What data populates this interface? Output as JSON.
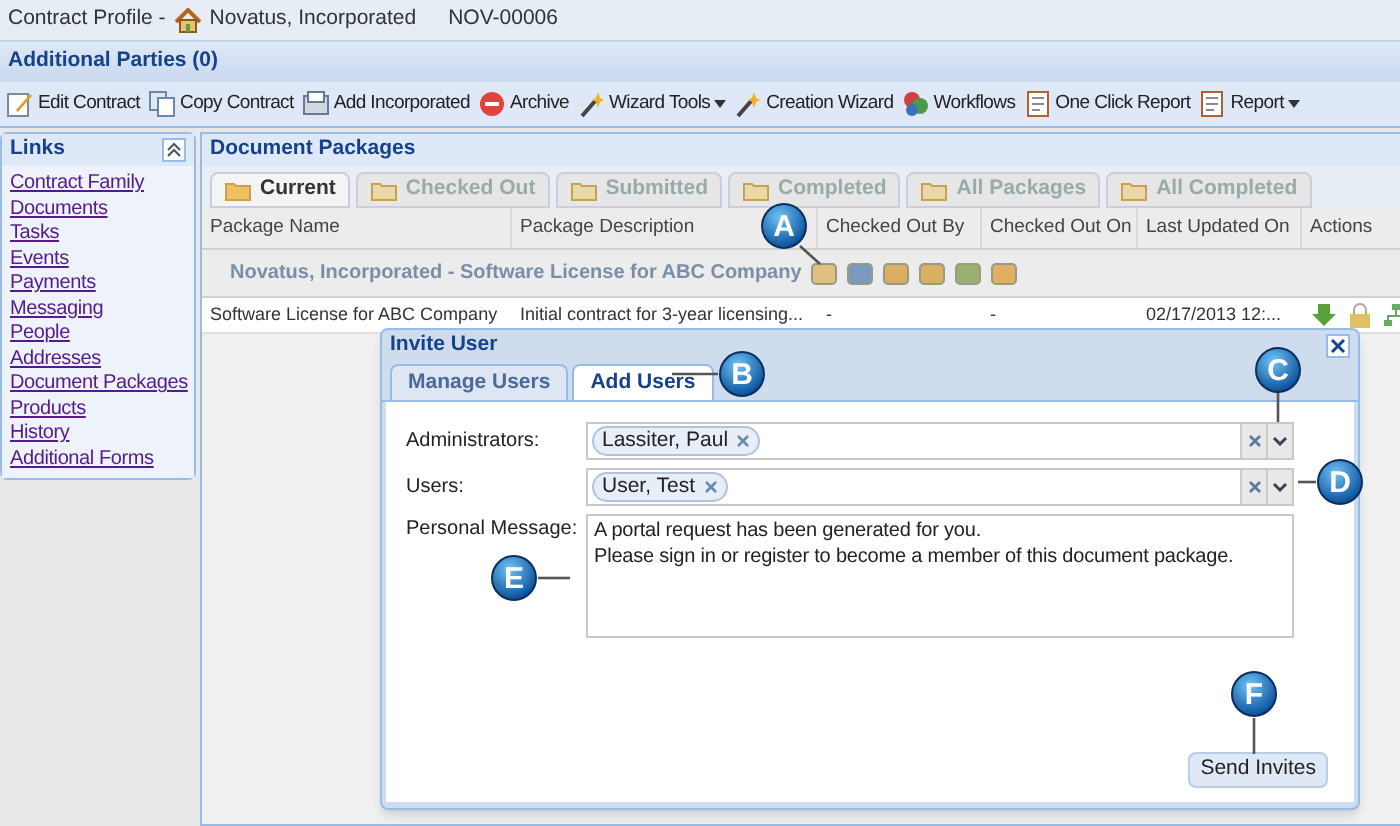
{
  "header": {
    "label": "Contract Profile -",
    "party": "Novatus, Incorporated",
    "code": "NOV-00006"
  },
  "section_title": "Additional Parties (0)",
  "toolbar": [
    {
      "label": "Edit Contract",
      "dropdown": false
    },
    {
      "label": "Copy Contract",
      "dropdown": false
    },
    {
      "label": "Add Incorporated",
      "dropdown": false
    },
    {
      "label": "Archive",
      "dropdown": false
    },
    {
      "label": "Wizard Tools",
      "dropdown": true
    },
    {
      "label": "Creation Wizard",
      "dropdown": false
    },
    {
      "label": "Workflows",
      "dropdown": false
    },
    {
      "label": "One Click Report",
      "dropdown": false
    },
    {
      "label": "Report",
      "dropdown": true
    }
  ],
  "links": {
    "title": "Links",
    "items": [
      "Contract Family",
      "Documents",
      "Tasks",
      "Events",
      "Payments",
      "Messaging",
      "People",
      "Addresses",
      "Document Packages",
      "Products",
      "History",
      "Additional Forms"
    ]
  },
  "document_packages": {
    "title": "Document Packages",
    "tabs": [
      {
        "label": "Current",
        "selected": true
      },
      {
        "label": "Checked Out",
        "selected": false
      },
      {
        "label": "Submitted",
        "selected": false
      },
      {
        "label": "Completed",
        "selected": false
      },
      {
        "label": "All Packages",
        "selected": false
      },
      {
        "label": "All Completed",
        "selected": false
      }
    ],
    "columns": [
      "Package Name",
      "Package Description",
      "Checked Out By",
      "Checked Out On",
      "Last Updated On",
      "Actions"
    ],
    "group_title": "Novatus, Incorporated - Software License for ABC Company",
    "rows": [
      {
        "cells": [
          "Software License for ABC Company",
          "Initial contract for 3-year licensing...",
          "-",
          "-",
          "02/17/2013 12:..."
        ]
      }
    ]
  },
  "dialog": {
    "title": "Invite User",
    "tabs": [
      {
        "label": "Manage Users",
        "selected": false
      },
      {
        "label": "Add Users",
        "selected": true
      }
    ],
    "fields": [
      {
        "label": "Administrators:",
        "tokens": [
          "Lassiter, Paul"
        ]
      },
      {
        "label": "Users:",
        "tokens": [
          "User, Test"
        ]
      }
    ],
    "message": {
      "label": "Personal Message:",
      "value": "A portal request has been generated for you.\nPlease sign in or register to become a member of this document package."
    },
    "button": "Send Invites"
  },
  "callouts": [
    "A",
    "B",
    "C",
    "D",
    "E",
    "F"
  ]
}
